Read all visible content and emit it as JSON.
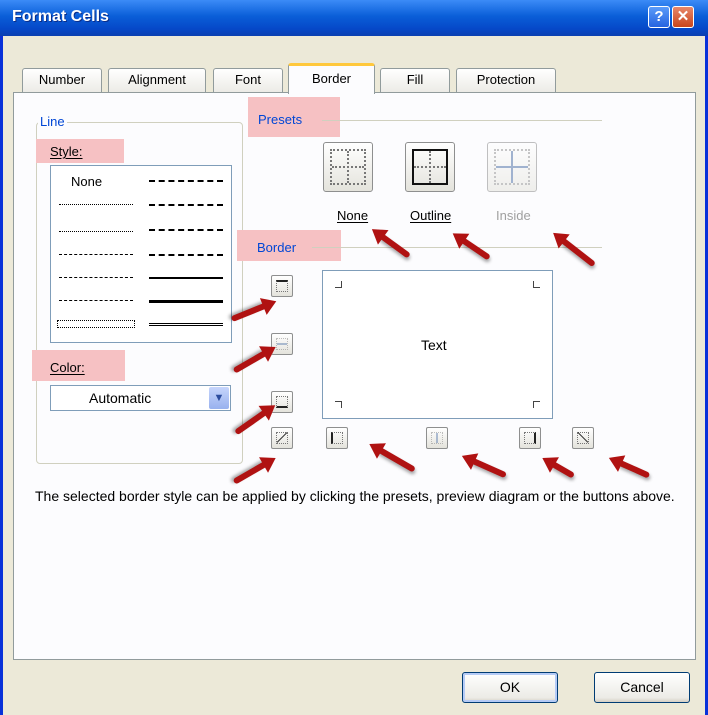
{
  "window": {
    "title": "Format Cells",
    "help": "?",
    "close": "✕"
  },
  "tabs": [
    {
      "label": "Number"
    },
    {
      "label": "Alignment"
    },
    {
      "label": "Font"
    },
    {
      "label": "Border",
      "active": true
    },
    {
      "label": "Fill"
    },
    {
      "label": "Protection"
    }
  ],
  "line": {
    "group_label": "Line",
    "style_label": "Style:",
    "style_none": "None",
    "color_label": "Color:",
    "color_value": "Automatic"
  },
  "presets": {
    "label": "Presets",
    "items": [
      {
        "label": "None"
      },
      {
        "label": "Outline"
      },
      {
        "label": "Inside",
        "disabled": true
      }
    ]
  },
  "border": {
    "label": "Border",
    "preview_text": "Text"
  },
  "description": "The selected border style can be applied by clicking the presets, preview diagram or the buttons above.",
  "buttons": {
    "ok": "OK",
    "cancel": "Cancel"
  },
  "colors": {
    "titlebar": "#0A5ED8",
    "highlight": "#F6C1C3",
    "arrow": "#B01212",
    "group_label": "#0046D5"
  }
}
